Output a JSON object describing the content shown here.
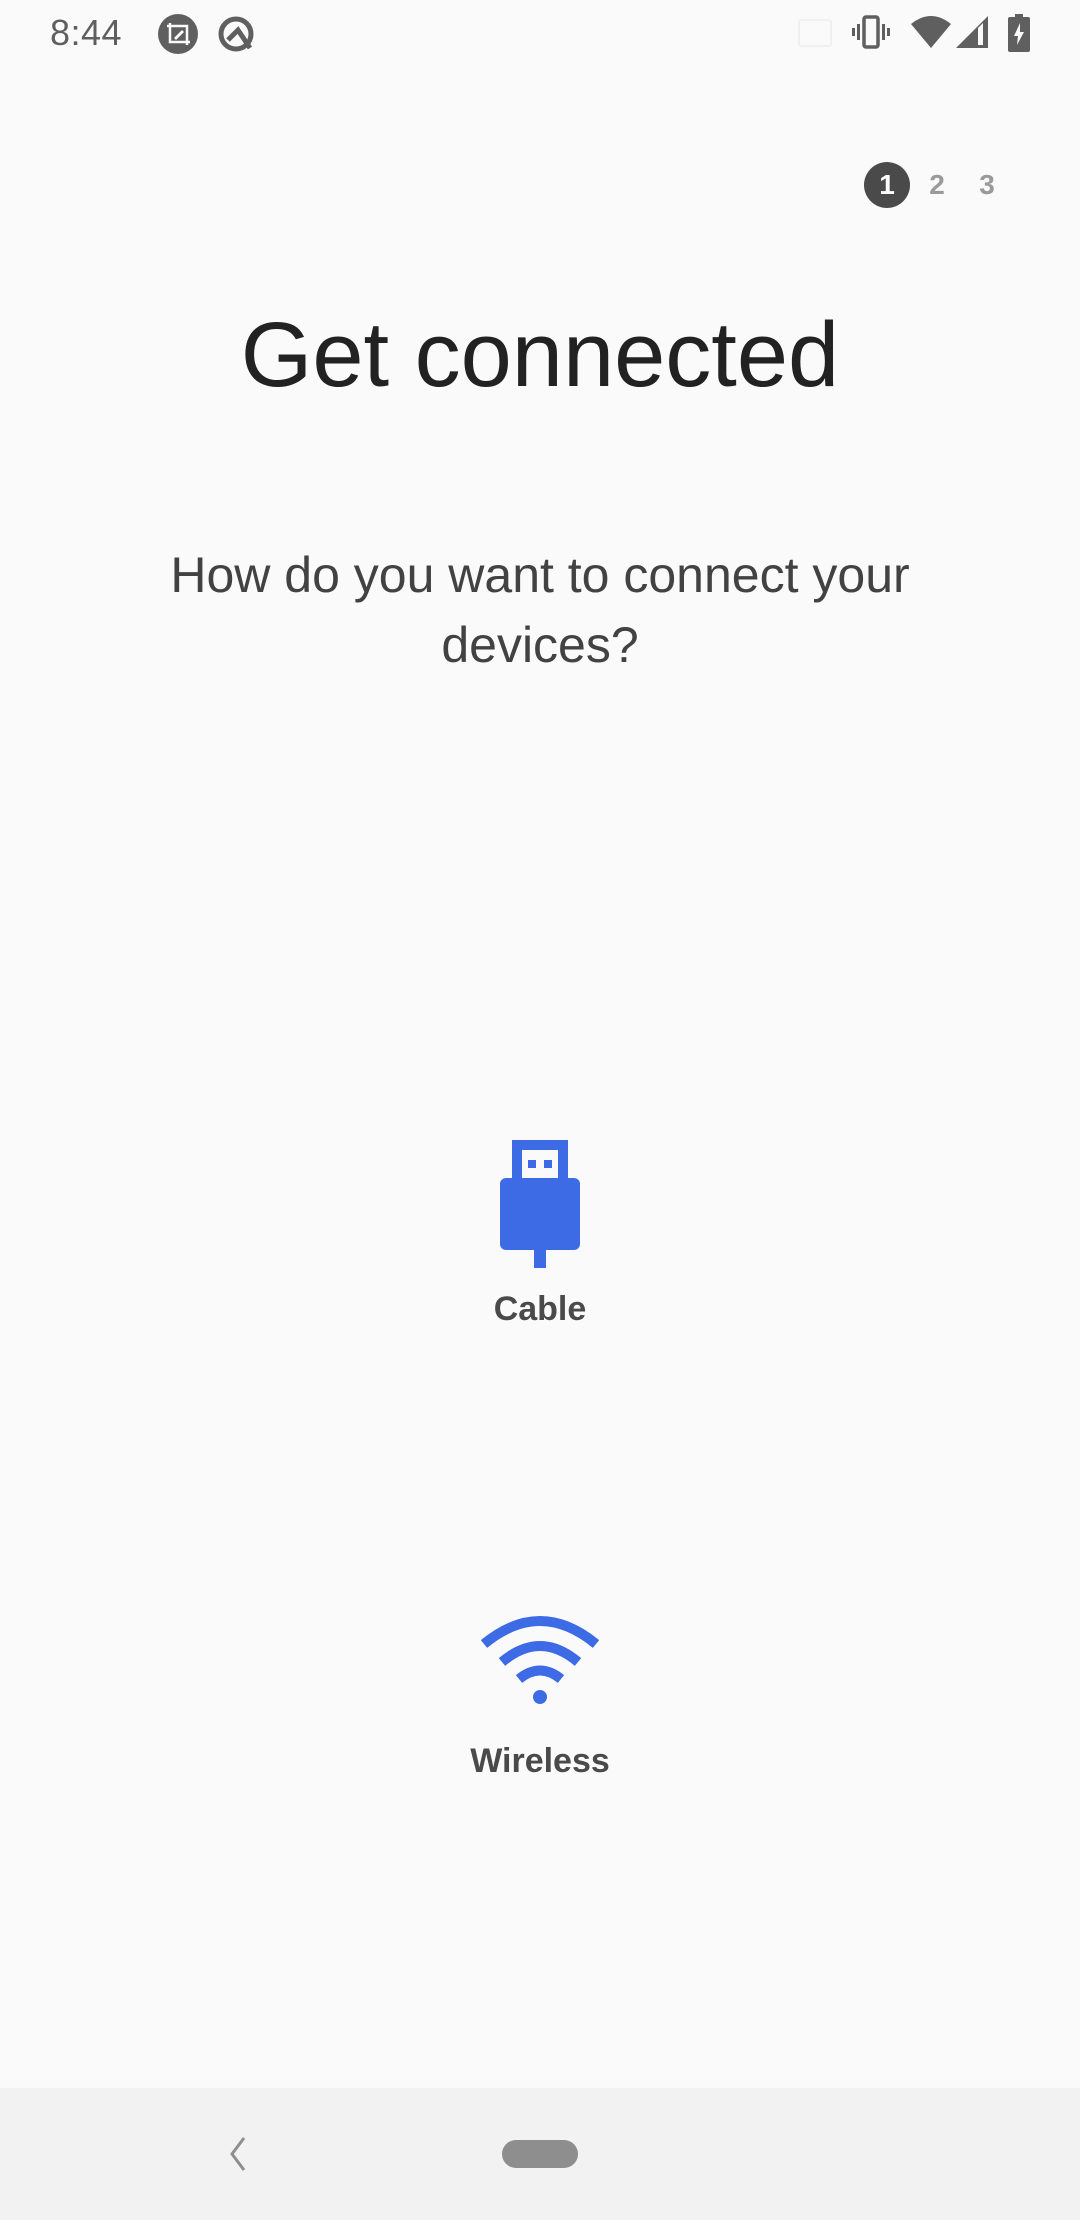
{
  "status_bar": {
    "time": "8:44",
    "left_icons": [
      "screenshot-edit-icon",
      "android-q-icon"
    ],
    "right_icons": [
      "cast-icon",
      "vibrate-icon",
      "wifi-signal-icon",
      "cellular-signal-icon",
      "battery-charging-icon"
    ]
  },
  "steps": {
    "current": 1,
    "items": [
      "1",
      "2",
      "3"
    ]
  },
  "page": {
    "title": "Get connected",
    "subtitle": "How do you want to connect your devices?"
  },
  "options": [
    {
      "label": "Cable",
      "icon": "usb-cable-icon"
    },
    {
      "label": "Wireless",
      "icon": "wifi-icon"
    }
  ],
  "colors": {
    "accent": "#3d6be5",
    "text_primary": "#222222",
    "text_secondary": "#424242",
    "background": "#fafafa"
  },
  "nav_bar": {
    "back_icon": "back-chevron-icon",
    "home_icon": "home-pill-icon"
  }
}
